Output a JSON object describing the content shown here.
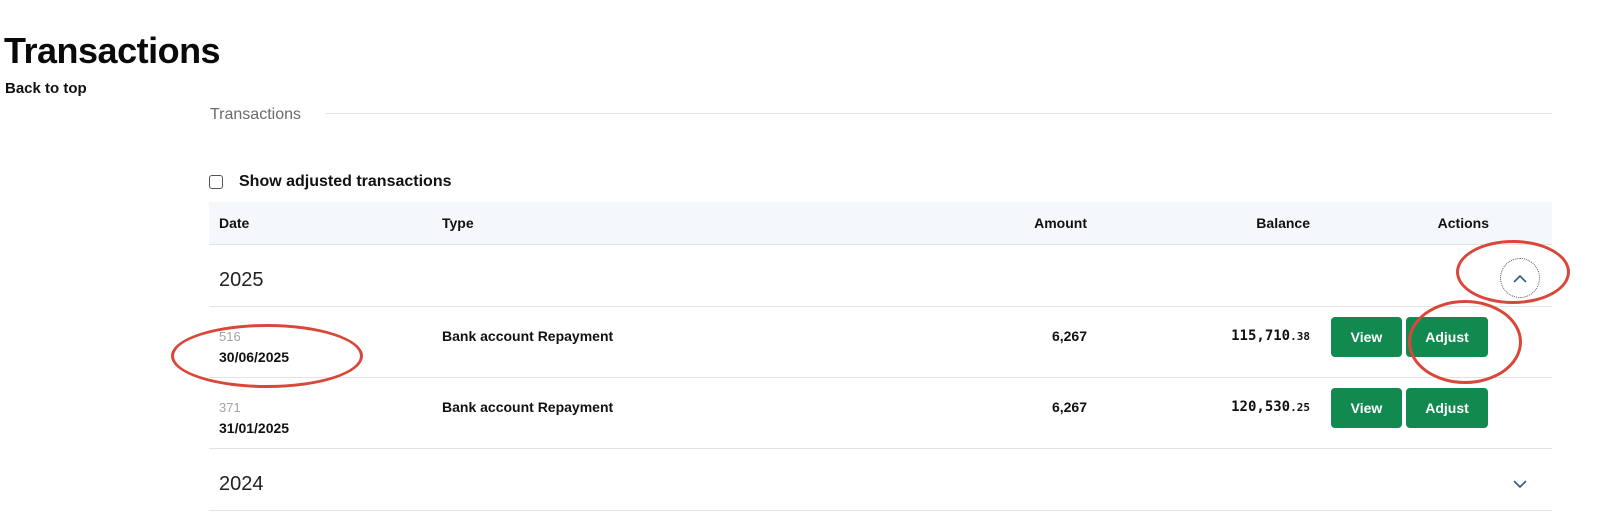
{
  "page": {
    "title": "Transactions",
    "back_link": "Back to top"
  },
  "section": {
    "label": "Transactions",
    "show_adjusted_label": "Show adjusted transactions",
    "show_adjusted_checked": false
  },
  "table": {
    "headers": {
      "date": "Date",
      "type": "Type",
      "amount": "Amount",
      "balance": "Balance",
      "actions": "Actions"
    },
    "groups": [
      {
        "year": "2025",
        "expanded": true,
        "toggle_icon": "chevron-up-icon",
        "rows": [
          {
            "id": "516",
            "date": "30/06/2025",
            "type": "Bank account Repayment",
            "amount": "6,267",
            "balance_int": "115,710",
            "balance_dec": ".38",
            "view_label": "View",
            "adjust_label": "Adjust"
          },
          {
            "id": "371",
            "date": "31/01/2025",
            "type": "Bank account Repayment",
            "amount": "6,267",
            "balance_int": "120,530",
            "balance_dec": ".25",
            "view_label": "View",
            "adjust_label": "Adjust"
          }
        ]
      },
      {
        "year": "2024",
        "expanded": false,
        "toggle_icon": "chevron-down-icon",
        "rows": []
      }
    ]
  },
  "colors": {
    "accent_button": "#128a4f",
    "header_background": "#f5f8fb",
    "chevron": "#2f5b8a",
    "annotation": "#d9473a"
  }
}
